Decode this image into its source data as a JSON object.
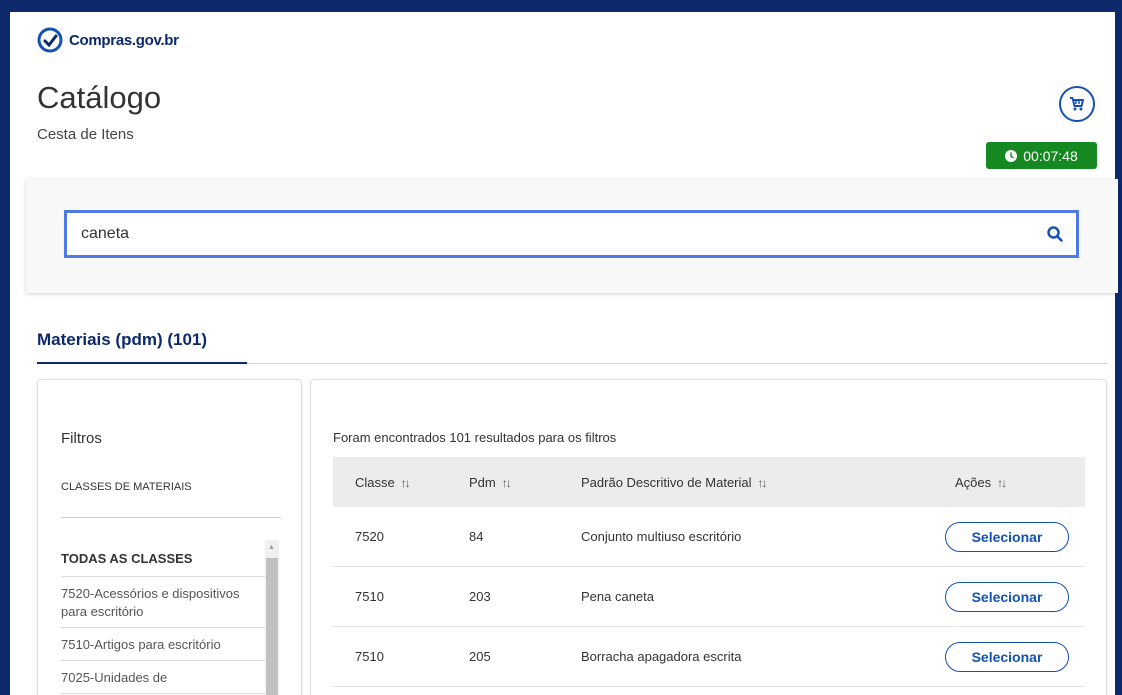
{
  "brand": {
    "logo_text": "Compras.gov.br",
    "color": "#0c2a6b"
  },
  "header": {
    "title": "Catálogo",
    "subtitle": "Cesta de Itens",
    "cart_icon": "cart-icon",
    "timer": "00:07:48",
    "timer_icon": "clock-icon"
  },
  "search": {
    "value": "caneta",
    "placeholder": "",
    "icon": "search-icon"
  },
  "tabs": [
    {
      "label": "Materiais (pdm) (101)",
      "active": true
    }
  ],
  "filters": {
    "title": "Filtros",
    "section": "CLASSES DE MATERIAIS",
    "items": [
      {
        "label": "TODAS AS CLASSES"
      },
      {
        "label": "7520-Acessórios e dispositivos para escritório"
      },
      {
        "label": "7510-Artigos para escritório"
      },
      {
        "label": "7025-Unidades de"
      }
    ]
  },
  "results": {
    "summary": "Foram encontrados 101 resultados para os filtros",
    "columns": [
      "Classe",
      "Pdm",
      "Padrão Descritivo de Material",
      "Ações"
    ],
    "sort_icon": "↑↓",
    "rows": [
      {
        "classe": "7520",
        "pdm": "84",
        "descricao": "Conjunto multiuso escritório",
        "acao": "Selecionar"
      },
      {
        "classe": "7510",
        "pdm": "203",
        "descricao": "Pena caneta",
        "acao": "Selecionar"
      },
      {
        "classe": "7510",
        "pdm": "205",
        "descricao": "Borracha apagadora escrita",
        "acao": "Selecionar"
      }
    ]
  },
  "colors": {
    "primary": "#1351b4",
    "success": "#168821",
    "search_border": "#4e7ae4"
  }
}
